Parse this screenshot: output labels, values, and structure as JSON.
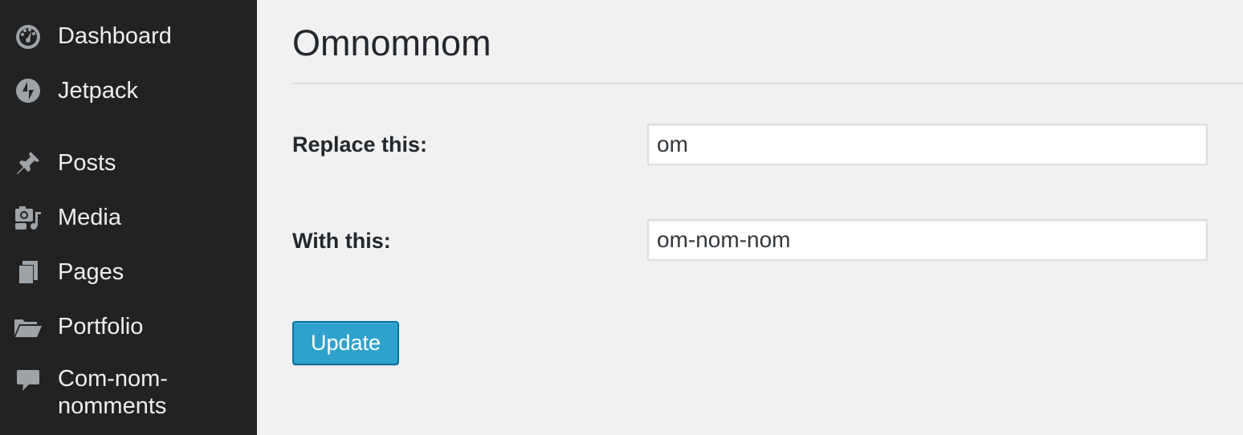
{
  "sidebar": {
    "items": [
      {
        "label": "Dashboard",
        "icon": "dashboard-icon"
      },
      {
        "label": "Jetpack",
        "icon": "jetpack-icon"
      },
      {
        "label": "Posts",
        "icon": "pin-icon"
      },
      {
        "label": "Media",
        "icon": "media-icon"
      },
      {
        "label": "Pages",
        "icon": "pages-icon"
      },
      {
        "label": "Portfolio",
        "icon": "folder-icon"
      },
      {
        "label": "Com-nom-nomments",
        "icon": "comment-icon"
      }
    ]
  },
  "main": {
    "title": "Omnomnom",
    "fields": [
      {
        "label": "Replace this:",
        "value": "om"
      },
      {
        "label": "With this:",
        "value": "om-nom-nom"
      }
    ],
    "update_label": "Update"
  },
  "colors": {
    "sidebar_bg": "#222222",
    "page_bg": "#f1f1f1",
    "button_bg": "#2ea2cc",
    "button_border": "#0074a2"
  }
}
